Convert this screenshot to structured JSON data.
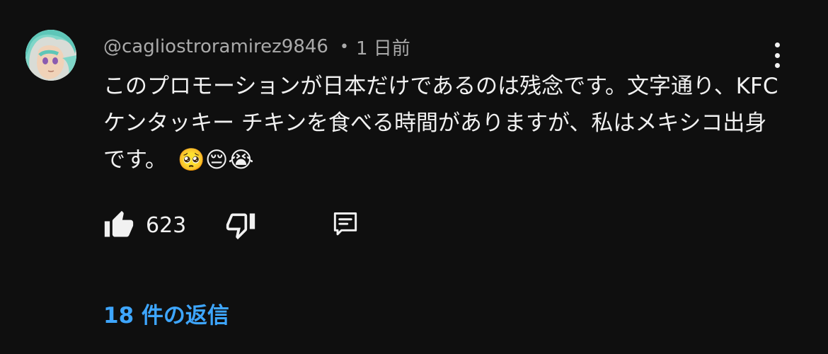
{
  "comment": {
    "author": "@cagliostroramirez9846",
    "separator": "•",
    "time": "1 日前",
    "text": "このプロモーションが日本だけであるのは残念です。文字通り、KFC ケンタッキー チキンを食べる時間がありますが、私はメキシコ出身です。　🥺😔😭",
    "like_count": "623",
    "replies_label": "18 件の返信"
  },
  "icons": {
    "avatar": "anime-avatar",
    "menu": "more-vert-icon",
    "like": "thumb-up-filled-icon",
    "dislike": "thumb-down-outline-icon",
    "reply": "comment-icon"
  },
  "colors": {
    "background": "#0f0f0f",
    "text": "#f1f1f1",
    "secondary_text": "#aaaaaa",
    "link": "#3ea6ff"
  }
}
